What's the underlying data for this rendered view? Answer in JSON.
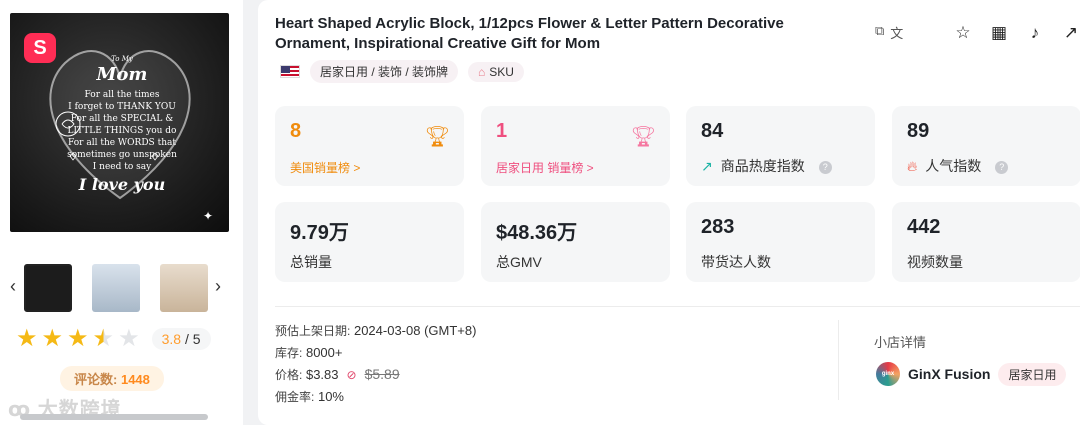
{
  "product": {
    "title": "Heart Shaped Acrylic Block, 1/12pcs Flower & Letter Pattern Decorative Ornament, Inspirational Creative Gift for Mom",
    "category": "居家日用 / 装饰 / 装饰牌",
    "sku_label": "SKU",
    "country_flag": "us-flag-icon"
  },
  "image_text": {
    "to_my": "To My",
    "mom": "Mom",
    "lines": [
      "For all the times",
      "I forget to THANK YOU",
      "For all the SPECIAL &",
      "LITTLE THINGS you do",
      "For all the WORDS that",
      "sometimes go unspoken",
      "I need to say"
    ],
    "love": "I love you"
  },
  "brand_badge": "S",
  "rating": {
    "score": "3.8",
    "max": "/ 5",
    "stars_filled": 3.5,
    "stars_total": 5
  },
  "reviews": {
    "label": "评论数:",
    "count": "1448"
  },
  "watermark": "大数跨境",
  "stats": {
    "us_rank": {
      "value": "8",
      "label": "美国销量榜 >"
    },
    "cat_rank": {
      "value": "1",
      "label": "居家日用 销量榜 >"
    },
    "heat": {
      "value": "84",
      "label": "商品热度指数"
    },
    "popularity": {
      "value": "89",
      "label": "人气指数"
    },
    "sales": {
      "value": "9.79万",
      "label": "总销量"
    },
    "gmv": {
      "value": "$48.36万",
      "label": "总GMV"
    },
    "creators": {
      "value": "283",
      "label": "带货达人数"
    },
    "videos": {
      "value": "442",
      "label": "视频数量"
    }
  },
  "details": {
    "date_label": "预估上架日期:",
    "date_value": "2024-03-08 (GMT+8)",
    "stock_label": "库存:",
    "stock_value": "8000+",
    "price_label": "价格:",
    "price_value": "$3.83",
    "price_original": "$5.89",
    "commission_label": "佣金率:",
    "commission_value": "10%"
  },
  "shop": {
    "heading": "小店详情",
    "name": "GinX Fusion",
    "tag": "居家日用",
    "logo_text": "ginx"
  },
  "colors": {
    "accent_orange": "#f08c0e",
    "accent_pink": "#ef4f7f",
    "star": "#f5b915"
  }
}
